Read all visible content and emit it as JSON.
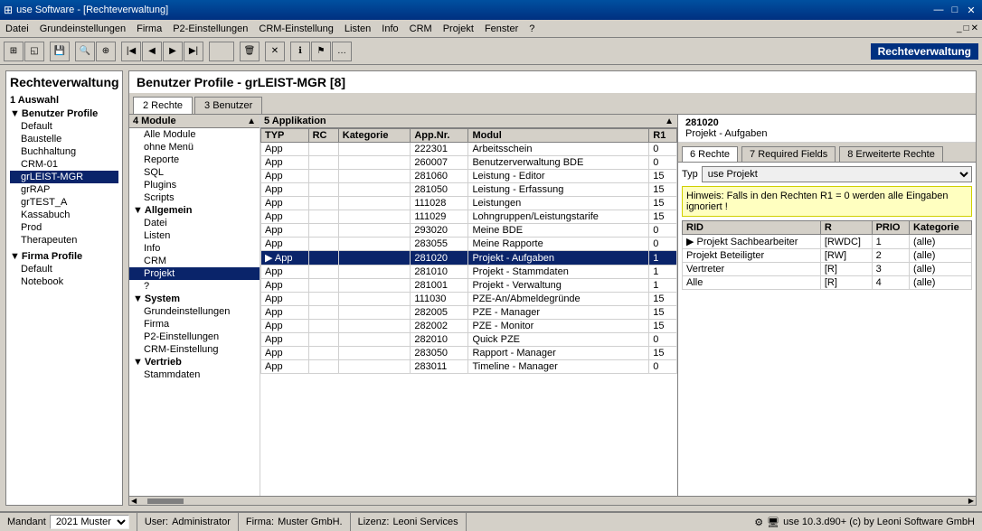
{
  "window": {
    "title": "use Software - [Rechteverwaltung]",
    "controls": [
      "—",
      "□",
      "✕"
    ]
  },
  "menu": {
    "items": [
      "Datei",
      "Grundeinstellungen",
      "Firma",
      "P2-Einstellungen",
      "CRM-Einstellung",
      "Listen",
      "Info",
      "CRM",
      "Projekt",
      "Fenster",
      "?"
    ]
  },
  "toolbar": {
    "right_label": "Rechteverwaltung"
  },
  "page_title": "Rechteverwaltung",
  "section1_label": "1 Auswahl",
  "left_tree": {
    "benutzer_profile_label": "Benutzer Profile",
    "items_benutzer": [
      "Default",
      "Baustelle",
      "Buchhaltung",
      "CRM-01",
      "grLEIST-MGR",
      "grRAP",
      "grTEST_A",
      "Kassabuch",
      "Prod",
      "Therapeuten"
    ],
    "firma_profile_label": "Firma Profile",
    "items_firma": [
      "Default",
      "Notebook"
    ]
  },
  "main_title": "Benutzer Profile - grLEIST-MGR [8]",
  "tabs": [
    {
      "label": "2 Rechte",
      "active": true
    },
    {
      "label": "3 Benutzer",
      "active": false
    }
  ],
  "module_section": {
    "header": "4 Module",
    "items": [
      {
        "label": "Alle Module",
        "level": 1
      },
      {
        "label": "ohne Menü",
        "level": 1
      },
      {
        "label": "Reporte",
        "level": 1
      },
      {
        "label": "SQL",
        "level": 1
      },
      {
        "label": "Plugins",
        "level": 1
      },
      {
        "label": "Scripts",
        "level": 1
      },
      {
        "label": "Allgemein",
        "level": 0,
        "group": true
      },
      {
        "label": "Datei",
        "level": 1
      },
      {
        "label": "Listen",
        "level": 1
      },
      {
        "label": "Info",
        "level": 1
      },
      {
        "label": "CRM",
        "level": 1
      },
      {
        "label": "Projekt",
        "level": 1,
        "selected": true
      },
      {
        "label": "?",
        "level": 1
      },
      {
        "label": "System",
        "level": 0,
        "group": true
      },
      {
        "label": "Grundeinstellungen",
        "level": 1
      },
      {
        "label": "Firma",
        "level": 1
      },
      {
        "label": "P2-Einstellungen",
        "level": 1
      },
      {
        "label": "CRM-Einstellung",
        "level": 1
      },
      {
        "label": "Vertrieb",
        "level": 0,
        "group": true
      },
      {
        "label": "Stammdaten",
        "level": 1
      }
    ]
  },
  "applikation_section": {
    "header": "5 Applikation",
    "columns": [
      "TYP",
      "RC",
      "Kategorie",
      "App.Nr.",
      "Modul",
      "R1"
    ],
    "rows": [
      {
        "typ": "App",
        "rc": "",
        "kategorie": "",
        "app_nr": "222301",
        "modul": "Arbeitsschein",
        "r1": "0"
      },
      {
        "typ": "App",
        "rc": "",
        "kategorie": "",
        "app_nr": "260007",
        "modul": "Benutzerverwaltung BDE",
        "r1": "0"
      },
      {
        "typ": "App",
        "rc": "",
        "kategorie": "",
        "app_nr": "281060",
        "modul": "Leistung - Editor",
        "r1": "15"
      },
      {
        "typ": "App",
        "rc": "",
        "kategorie": "",
        "app_nr": "281050",
        "modul": "Leistung - Erfassung",
        "r1": "15"
      },
      {
        "typ": "App",
        "rc": "",
        "kategorie": "",
        "app_nr": "111028",
        "modul": "Leistungen",
        "r1": "15"
      },
      {
        "typ": "App",
        "rc": "",
        "kategorie": "",
        "app_nr": "111029",
        "modul": "Lohngruppen/Leistungstarife",
        "r1": "15"
      },
      {
        "typ": "App",
        "rc": "",
        "kategorie": "",
        "app_nr": "293020",
        "modul": "Meine BDE",
        "r1": "0"
      },
      {
        "typ": "App",
        "rc": "",
        "kategorie": "",
        "app_nr": "283055",
        "modul": "Meine Rapporte",
        "r1": "0"
      },
      {
        "typ": "App",
        "rc": "",
        "kategorie": "",
        "app_nr": "281020",
        "modul": "Projekt - Aufgaben",
        "r1": "1",
        "selected": true,
        "arrow": true
      },
      {
        "typ": "App",
        "rc": "",
        "kategorie": "",
        "app_nr": "281010",
        "modul": "Projekt - Stammdaten",
        "r1": "1"
      },
      {
        "typ": "App",
        "rc": "",
        "kategorie": "",
        "app_nr": "281001",
        "modul": "Projekt - Verwaltung",
        "r1": "1"
      },
      {
        "typ": "App",
        "rc": "",
        "kategorie": "",
        "app_nr": "111030",
        "modul": "PZE-An/Abmeldegründe",
        "r1": "15"
      },
      {
        "typ": "App",
        "rc": "",
        "kategorie": "",
        "app_nr": "282005",
        "modul": "PZE - Manager",
        "r1": "15"
      },
      {
        "typ": "App",
        "rc": "",
        "kategorie": "",
        "app_nr": "282002",
        "modul": "PZE - Monitor",
        "r1": "15"
      },
      {
        "typ": "App",
        "rc": "",
        "kategorie": "",
        "app_nr": "282010",
        "modul": "Quick PZE",
        "r1": "0"
      },
      {
        "typ": "App",
        "rc": "",
        "kategorie": "",
        "app_nr": "283050",
        "modul": "Rapport - Manager",
        "r1": "15"
      },
      {
        "typ": "App",
        "rc": "",
        "kategorie": "",
        "app_nr": "283011",
        "modul": "Timeline - Manager",
        "r1": "0"
      }
    ]
  },
  "right_panel": {
    "header_num": "281020",
    "header_title": "Projekt - Aufgaben",
    "tabs": [
      {
        "label": "6 Rechte",
        "active": true
      },
      {
        "label": "7 Required Fields"
      },
      {
        "label": "8 Erweiterte Rechte"
      }
    ],
    "typ_label": "Typ",
    "typ_value": "use Projekt",
    "hint": "Hinweis: Falls in den Rechten R1 = 0 werden alle Eingaben ignoriert !",
    "rights_columns": [
      "RID",
      "R",
      "PRIO",
      "Kategorie"
    ],
    "rights_rows": [
      {
        "rid": "Projekt Sachbearbeiter",
        "r": "[RWDC]",
        "prio": "1",
        "kategorie": "(alle)"
      },
      {
        "rid": "Projekt Beteiligter",
        "r": "[RW]",
        "prio": "2",
        "kategorie": "(alle)"
      },
      {
        "rid": "Vertreter",
        "r": "[R]",
        "prio": "3",
        "kategorie": "(alle)"
      },
      {
        "rid": "Alle",
        "r": "[R]",
        "prio": "4",
        "kategorie": "(alle)"
      }
    ]
  },
  "status_bar": {
    "mandant_label": "Mandant",
    "mandant_value": "2021 Muster",
    "user_label": "User:",
    "user_value": "Administrator",
    "firma_label": "Firma:",
    "firma_value": "Muster GmbH.",
    "lizenz_label": "Lizenz:",
    "lizenz_value": "Leoni Services",
    "version": "use 10.3.d90+ (c) by Leoni Software GmbH"
  }
}
